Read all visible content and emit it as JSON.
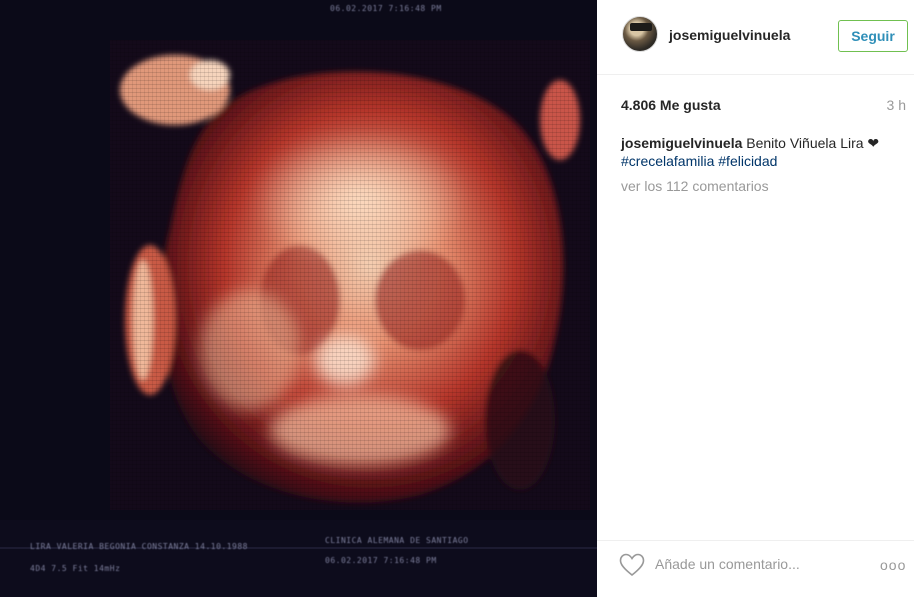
{
  "post": {
    "image_alt": "3D ultrasound scan",
    "scan_text": {
      "top": "06.02.2017   7:16:48 PM",
      "bottom_line1": "LIRA VALERIA BEGONIA CONSTANZA  14.10.1988",
      "bottom_line2": "CLINICA ALEMANA DE SANTIAGO",
      "bottom_line3": "06.02.2017   7:16:48 PM",
      "bottom_left": "4D4 7.5   Fit 14mHz"
    }
  },
  "header": {
    "username": "josemiguelvinuela",
    "follow_label": "Seguir"
  },
  "stats": {
    "likes": "4.806 Me gusta",
    "time": "3 h"
  },
  "caption": {
    "user": "josemiguelvinuela",
    "text": " Benito Viñuela Lira ❤",
    "tag1": "#crecelafamilia",
    "tag2": "#felicidad"
  },
  "comments": {
    "link": "ver los 112 comentarios"
  },
  "footer": {
    "placeholder": "Añade un comentario...",
    "more": "ooo"
  },
  "colors": {
    "follow_text": "#2f8fb8",
    "follow_border": "#70c050",
    "hashtag": "#003569",
    "muted": "#999999"
  }
}
